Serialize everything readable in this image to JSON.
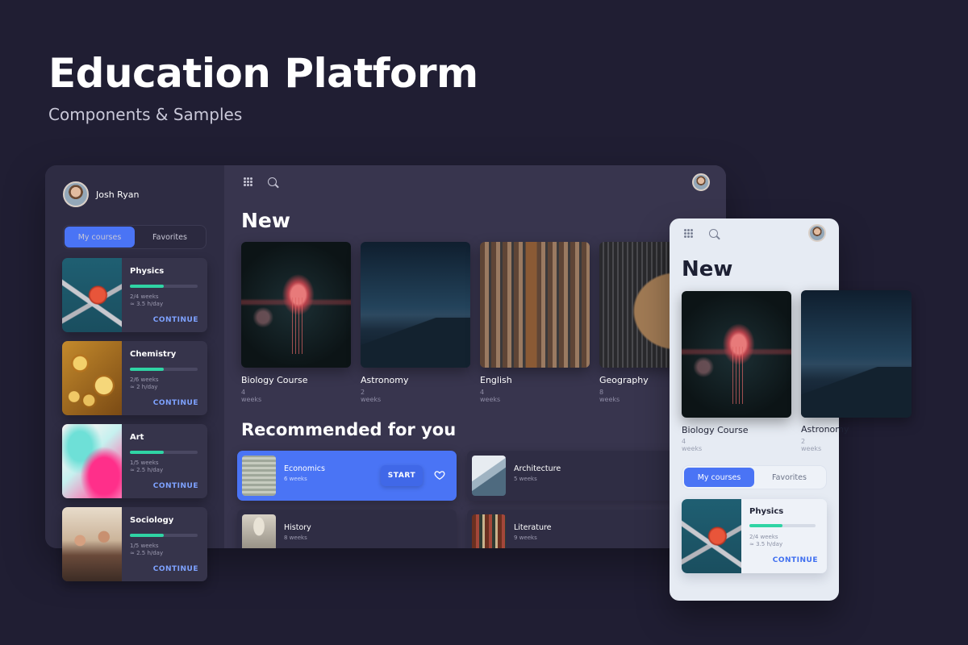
{
  "hero": {
    "title": "Education Platform",
    "subtitle": "Components & Samples"
  },
  "desktop": {
    "user": {
      "name": "Josh Ryan"
    },
    "tabs": [
      {
        "label": "My courses",
        "active": true
      },
      {
        "label": "Favorites",
        "active": false
      }
    ],
    "courses": [
      {
        "title": "Physics",
        "weeks": "2/4 weeks",
        "pace": "≈ 3.5 h/day",
        "progress": 0.5,
        "action": "CONTINUE"
      },
      {
        "title": "Chemistry",
        "weeks": "2/6 weeks",
        "pace": "≈ 2 h/day",
        "progress": 0.5,
        "action": "CONTINUE"
      },
      {
        "title": "Art",
        "weeks": "1/5 weeks",
        "pace": "≈ 2.5 h/day",
        "progress": 0.5,
        "action": "CONTINUE"
      },
      {
        "title": "Sociology",
        "weeks": "1/5 weeks",
        "pace": "≈ 2.5 h/day",
        "progress": 0.5,
        "action": "CONTINUE"
      }
    ],
    "new_section": {
      "title": "New",
      "items": [
        {
          "title": "Biology Course",
          "duration": "4 weeks"
        },
        {
          "title": "Astronomy",
          "duration": "2 weeks"
        },
        {
          "title": "English",
          "duration": "4 weeks"
        },
        {
          "title": "Geography",
          "duration": "8 weeks"
        }
      ]
    },
    "recommended": {
      "title": "Recommended for you",
      "items": [
        {
          "title": "Economics",
          "duration": "6 weeks",
          "action": "START",
          "highlighted": true
        },
        {
          "title": "Architecture",
          "duration": "5 weeks"
        },
        {
          "title": "History",
          "duration": "8 weeks"
        },
        {
          "title": "Literature",
          "duration": "9 weeks"
        }
      ]
    }
  },
  "mobile": {
    "new_section": {
      "title": "New",
      "items": [
        {
          "title": "Biology Course",
          "duration": "4 weeks"
        },
        {
          "title": "Astronomy",
          "duration": "2 weeks"
        }
      ]
    },
    "tabs": [
      {
        "label": "My courses",
        "active": true
      },
      {
        "label": "Favorites",
        "active": false
      }
    ],
    "course": {
      "title": "Physics",
      "weeks": "2/4 weeks",
      "pace": "≈ 3.5 h/day",
      "progress": 0.5,
      "action": "CONTINUE"
    }
  },
  "icons": {
    "apps": "grid-icon",
    "search": "search-icon",
    "favorite": "heart-icon",
    "profile": "avatar"
  },
  "colors": {
    "background": "#201e33",
    "accent": "#4a74f5",
    "progress": "#2fd4a4",
    "continue": "#7ea2ff"
  }
}
